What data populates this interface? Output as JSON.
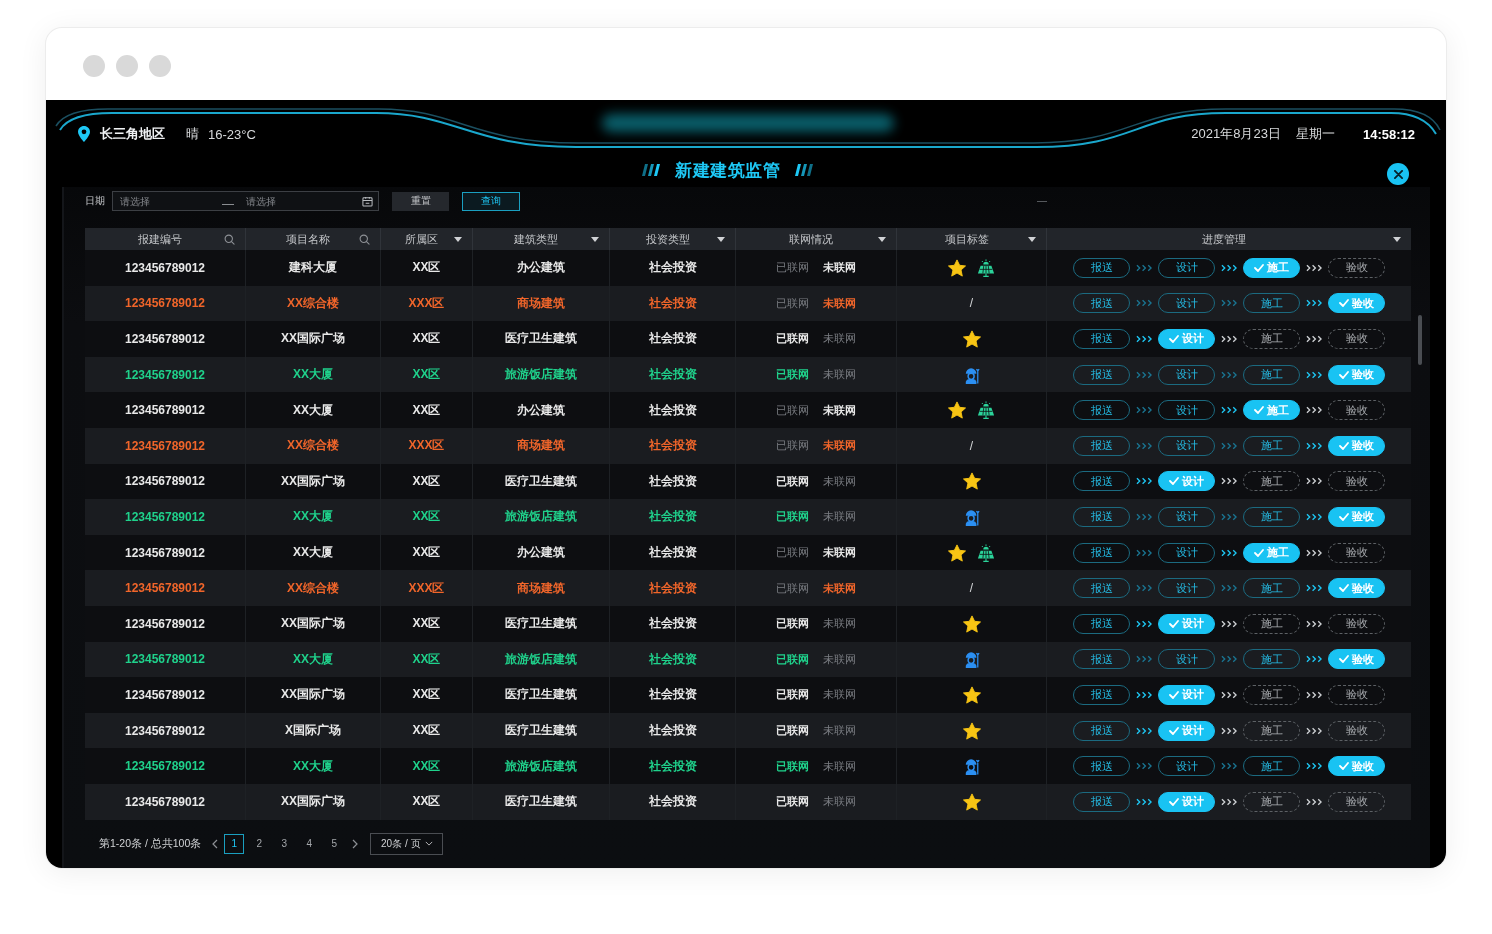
{
  "header": {
    "location": "长三角地区",
    "weather": "晴",
    "temperature": "16-23°C",
    "title": "新建建筑监管",
    "date": "2021年8月23日",
    "weekday": "星期一",
    "time": "14:58:12"
  },
  "filter": {
    "label": "日期",
    "start": {
      "placeholder": "请选择"
    },
    "end": {
      "placeholder": "请选择"
    },
    "buttons": [
      {
        "label": "重置",
        "kind": "reset"
      },
      {
        "label": "查询",
        "kind": "query"
      }
    ]
  },
  "table": {
    "columns": [
      {
        "label": "报建编号",
        "kind": "search"
      },
      {
        "label": "项目名称",
        "kind": "search"
      },
      {
        "label": "所属区",
        "kind": "dropdown"
      },
      {
        "label": "建筑类型",
        "kind": "dropdown"
      },
      {
        "label": "投资类型",
        "kind": "dropdown"
      },
      {
        "label": "联网情况",
        "kind": "dropdown"
      },
      {
        "label": "项目标签",
        "kind": "dropdown"
      },
      {
        "label": "进度管理",
        "kind": "dropdown"
      }
    ],
    "rows": [
      {
        "color": "#e8e8e8",
        "cells": [
          "123456789012",
          "建科大厦",
          "XX区",
          "办公建筑",
          "社会投资"
        ],
        "network": [
          {
            "label": "已联网",
            "selected": false
          },
          {
            "label": "未联网",
            "selected": true
          }
        ],
        "tags": [
          {
            "kind": "star"
          },
          {
            "kind": "solar"
          }
        ],
        "progress": [
          {
            "label": "报送",
            "done": true,
            "selected": false
          },
          {
            "label": "设计",
            "done": true,
            "selected": false
          },
          {
            "label": "施工",
            "done": true,
            "selected": true
          },
          {
            "label": "验收",
            "done": false,
            "selected": false
          }
        ]
      },
      {
        "color": "#f0652a",
        "cells": [
          "123456789012",
          "XX综合楼",
          "XXX区",
          "商场建筑",
          "社会投资"
        ],
        "network": [
          {
            "label": "已联网",
            "selected": false
          },
          {
            "label": "未联网",
            "selected": true
          }
        ],
        "tags": [
          {
            "kind": "text",
            "text": "/"
          }
        ],
        "progress": [
          {
            "label": "报送",
            "done": true,
            "selected": false
          },
          {
            "label": "设计",
            "done": true,
            "selected": false
          },
          {
            "label": "施工",
            "done": true,
            "selected": false
          },
          {
            "label": "验收",
            "done": true,
            "selected": true
          }
        ]
      },
      {
        "color": "#e8e8e8",
        "cells": [
          "123456789012",
          "XX国际广场",
          "XX区",
          "医疗卫生建筑",
          "社会投资"
        ],
        "network": [
          {
            "label": "已联网",
            "selected": true
          },
          {
            "label": "未联网",
            "selected": false
          }
        ],
        "tags": [
          {
            "kind": "star"
          }
        ],
        "progress": [
          {
            "label": "报送",
            "done": true,
            "selected": false
          },
          {
            "label": "设计",
            "done": true,
            "selected": true
          },
          {
            "label": "施工",
            "done": false,
            "selected": false
          },
          {
            "label": "验收",
            "done": false,
            "selected": false
          }
        ]
      },
      {
        "color": "#1fd18b",
        "cells": [
          "123456789012",
          "XX大厦",
          "XX区",
          "旅游饭店建筑",
          "社会投资"
        ],
        "network": [
          {
            "label": "已联网",
            "selected": true
          },
          {
            "label": "未联网",
            "selected": false
          }
        ],
        "tags": [
          {
            "kind": "worker"
          }
        ],
        "progress": [
          {
            "label": "报送",
            "done": true,
            "selected": false
          },
          {
            "label": "设计",
            "done": true,
            "selected": false
          },
          {
            "label": "施工",
            "done": true,
            "selected": false
          },
          {
            "label": "验收",
            "done": true,
            "selected": true
          }
        ]
      },
      {
        "color": "#e8e8e8",
        "cells": [
          "123456789012",
          "XX大厦",
          "XX区",
          "办公建筑",
          "社会投资"
        ],
        "network": [
          {
            "label": "已联网",
            "selected": false
          },
          {
            "label": "未联网",
            "selected": true
          }
        ],
        "tags": [
          {
            "kind": "star"
          },
          {
            "kind": "solar"
          }
        ],
        "progress": [
          {
            "label": "报送",
            "done": true,
            "selected": false
          },
          {
            "label": "设计",
            "done": true,
            "selected": false
          },
          {
            "label": "施工",
            "done": true,
            "selected": true
          },
          {
            "label": "验收",
            "done": false,
            "selected": false
          }
        ]
      },
      {
        "color": "#f0652a",
        "cells": [
          "123456789012",
          "XX综合楼",
          "XXX区",
          "商场建筑",
          "社会投资"
        ],
        "network": [
          {
            "label": "已联网",
            "selected": false
          },
          {
            "label": "未联网",
            "selected": true
          }
        ],
        "tags": [
          {
            "kind": "text",
            "text": "/"
          }
        ],
        "progress": [
          {
            "label": "报送",
            "done": true,
            "selected": false
          },
          {
            "label": "设计",
            "done": true,
            "selected": false
          },
          {
            "label": "施工",
            "done": true,
            "selected": false
          },
          {
            "label": "验收",
            "done": true,
            "selected": true
          }
        ]
      },
      {
        "color": "#e8e8e8",
        "cells": [
          "123456789012",
          "XX国际广场",
          "XX区",
          "医疗卫生建筑",
          "社会投资"
        ],
        "network": [
          {
            "label": "已联网",
            "selected": true
          },
          {
            "label": "未联网",
            "selected": false
          }
        ],
        "tags": [
          {
            "kind": "star"
          }
        ],
        "progress": [
          {
            "label": "报送",
            "done": true,
            "selected": false
          },
          {
            "label": "设计",
            "done": true,
            "selected": true
          },
          {
            "label": "施工",
            "done": false,
            "selected": false
          },
          {
            "label": "验收",
            "done": false,
            "selected": false
          }
        ]
      },
      {
        "color": "#1fd18b",
        "cells": [
          "123456789012",
          "XX大厦",
          "XX区",
          "旅游饭店建筑",
          "社会投资"
        ],
        "network": [
          {
            "label": "已联网",
            "selected": true
          },
          {
            "label": "未联网",
            "selected": false
          }
        ],
        "tags": [
          {
            "kind": "worker"
          }
        ],
        "progress": [
          {
            "label": "报送",
            "done": true,
            "selected": false
          },
          {
            "label": "设计",
            "done": true,
            "selected": false
          },
          {
            "label": "施工",
            "done": true,
            "selected": false
          },
          {
            "label": "验收",
            "done": true,
            "selected": true
          }
        ]
      },
      {
        "color": "#e8e8e8",
        "cells": [
          "123456789012",
          "XX大厦",
          "XX区",
          "办公建筑",
          "社会投资"
        ],
        "network": [
          {
            "label": "已联网",
            "selected": false
          },
          {
            "label": "未联网",
            "selected": true
          }
        ],
        "tags": [
          {
            "kind": "star"
          },
          {
            "kind": "solar"
          }
        ],
        "progress": [
          {
            "label": "报送",
            "done": true,
            "selected": false
          },
          {
            "label": "设计",
            "done": true,
            "selected": false
          },
          {
            "label": "施工",
            "done": true,
            "selected": true
          },
          {
            "label": "验收",
            "done": false,
            "selected": false
          }
        ]
      },
      {
        "color": "#f0652a",
        "cells": [
          "123456789012",
          "XX综合楼",
          "XXX区",
          "商场建筑",
          "社会投资"
        ],
        "network": [
          {
            "label": "已联网",
            "selected": false
          },
          {
            "label": "未联网",
            "selected": true
          }
        ],
        "tags": [
          {
            "kind": "text",
            "text": "/"
          }
        ],
        "progress": [
          {
            "label": "报送",
            "done": true,
            "selected": false
          },
          {
            "label": "设计",
            "done": true,
            "selected": false
          },
          {
            "label": "施工",
            "done": true,
            "selected": false
          },
          {
            "label": "验收",
            "done": true,
            "selected": true
          }
        ]
      },
      {
        "color": "#e8e8e8",
        "cells": [
          "123456789012",
          "XX国际广场",
          "XX区",
          "医疗卫生建筑",
          "社会投资"
        ],
        "network": [
          {
            "label": "已联网",
            "selected": true
          },
          {
            "label": "未联网",
            "selected": false
          }
        ],
        "tags": [
          {
            "kind": "star"
          }
        ],
        "progress": [
          {
            "label": "报送",
            "done": true,
            "selected": false
          },
          {
            "label": "设计",
            "done": true,
            "selected": true
          },
          {
            "label": "施工",
            "done": false,
            "selected": false
          },
          {
            "label": "验收",
            "done": false,
            "selected": false
          }
        ]
      },
      {
        "color": "#1fd18b",
        "cells": [
          "123456789012",
          "XX大厦",
          "XX区",
          "旅游饭店建筑",
          "社会投资"
        ],
        "network": [
          {
            "label": "已联网",
            "selected": true
          },
          {
            "label": "未联网",
            "selected": false
          }
        ],
        "tags": [
          {
            "kind": "worker"
          }
        ],
        "progress": [
          {
            "label": "报送",
            "done": true,
            "selected": false
          },
          {
            "label": "设计",
            "done": true,
            "selected": false
          },
          {
            "label": "施工",
            "done": true,
            "selected": false
          },
          {
            "label": "验收",
            "done": true,
            "selected": true
          }
        ]
      },
      {
        "color": "#e8e8e8",
        "cells": [
          "123456789012",
          "XX国际广场",
          "XX区",
          "医疗卫生建筑",
          "社会投资"
        ],
        "network": [
          {
            "label": "已联网",
            "selected": true
          },
          {
            "label": "未联网",
            "selected": false
          }
        ],
        "tags": [
          {
            "kind": "star"
          }
        ],
        "progress": [
          {
            "label": "报送",
            "done": true,
            "selected": false
          },
          {
            "label": "设计",
            "done": true,
            "selected": true
          },
          {
            "label": "施工",
            "done": false,
            "selected": false
          },
          {
            "label": "验收",
            "done": false,
            "selected": false
          }
        ]
      },
      {
        "color": "#e8e8e8",
        "cells": [
          "123456789012",
          "X国际广场",
          "XX区",
          "医疗卫生建筑",
          "社会投资"
        ],
        "network": [
          {
            "label": "已联网",
            "selected": true
          },
          {
            "label": "未联网",
            "selected": false
          }
        ],
        "tags": [
          {
            "kind": "star"
          }
        ],
        "progress": [
          {
            "label": "报送",
            "done": true,
            "selected": false
          },
          {
            "label": "设计",
            "done": true,
            "selected": true
          },
          {
            "label": "施工",
            "done": false,
            "selected": false
          },
          {
            "label": "验收",
            "done": false,
            "selected": false
          }
        ]
      },
      {
        "color": "#1fd18b",
        "cells": [
          "123456789012",
          "XX大厦",
          "XX区",
          "旅游饭店建筑",
          "社会投资"
        ],
        "network": [
          {
            "label": "已联网",
            "selected": true
          },
          {
            "label": "未联网",
            "selected": false
          }
        ],
        "tags": [
          {
            "kind": "worker"
          }
        ],
        "progress": [
          {
            "label": "报送",
            "done": true,
            "selected": false
          },
          {
            "label": "设计",
            "done": true,
            "selected": false
          },
          {
            "label": "施工",
            "done": true,
            "selected": false
          },
          {
            "label": "验收",
            "done": true,
            "selected": true
          }
        ]
      },
      {
        "color": "#e8e8e8",
        "cells": [
          "123456789012",
          "XX国际广场",
          "XX区",
          "医疗卫生建筑",
          "社会投资"
        ],
        "network": [
          {
            "label": "已联网",
            "selected": true
          },
          {
            "label": "未联网",
            "selected": false
          }
        ],
        "tags": [
          {
            "kind": "star"
          }
        ],
        "progress": [
          {
            "label": "报送",
            "done": true,
            "selected": false
          },
          {
            "label": "设计",
            "done": true,
            "selected": true
          },
          {
            "label": "施工",
            "done": false,
            "selected": false
          },
          {
            "label": "验收",
            "done": false,
            "selected": false
          }
        ]
      }
    ]
  },
  "pagination": {
    "summary": "第1-20条 / 总共100条",
    "pages": [
      {
        "label": "1",
        "selected": true
      },
      {
        "label": "2",
        "selected": false
      },
      {
        "label": "3",
        "selected": false
      },
      {
        "label": "4",
        "selected": false
      },
      {
        "label": "5",
        "selected": false
      }
    ],
    "page_size": "20条 / 页"
  }
}
